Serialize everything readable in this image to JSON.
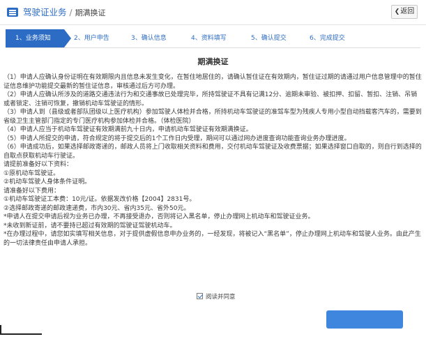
{
  "header": {
    "module": "驾驶证业务",
    "separator": "/",
    "page": "期满换证",
    "back_label": "返回"
  },
  "steps": [
    {
      "label": "1、业务须知",
      "active": true
    },
    {
      "label": "2、用户申告",
      "active": false
    },
    {
      "label": "3、确认信息",
      "active": false
    },
    {
      "label": "4、资料填写",
      "active": false
    },
    {
      "label": "5、确认提交",
      "active": false
    },
    {
      "label": "6、完成提交",
      "active": false
    }
  ],
  "notice": {
    "title": "期满换证",
    "paragraphs": [
      "（1）申请人应确认身份证明在有效期限内且信息未发生变化，在暂住地居住的，请确认暂住证在有效期内，暂住证过期的请通过用户信息管理中的暂住证信息维护功能提交最新的暂住证信息，审核通过后方可办理。",
      "（2）申请人应确认所涉及的道路交通违法行为和交通事故已处理完毕，所持驾驶证不具有记满12分、逾期未审验、被扣押、扣留、暂扣、注销、吊销或者锁定、注销可恢复，撤销机动车驾驶证的情形。",
      "（3）申请人到（县级或者部队团级以上医疗机构）参加驾驶人体检并合格，所持机动车驾驶证的准驾车型为残疾人专用小型自动挡载客汽车的，需要到省级卫生主管部门指定的专门医疗机构参加体检并合格。（体检医院）",
      "（4）申请人应当于机动车驾驶证有效期满前九十日内，申请机动车驾驶证有效期满换证。",
      "（5）申请人所提交的申请，符合规定的将于提交后的1个工作日内受理，期间可以通过网办进度查询功能查询业务办理进度。",
      "（6）申请成功后，如果选择邮政寄递的，邮政人员将上门收取相关资料和费用，交付机动车驾驶证及收费票据；如果选择窗口自取的，则自行到选择的自取点获取机动车行驶证。",
      "请提前准备好以下资料：",
      "①原机动车驾驶证。",
      "②机动车驾驶人身体条件证明。",
      "请准备好以下费用：",
      "①机动车驾驶证工本费：10元/证。依据发改价格【2004】2831号。",
      "②选择邮政寄递的邮政速递费，市内30元、省内35元、省外50元。",
      "*申请人在提交申请后视为业务已办理，不再接受退办，否则将记入黑名单，停止办理网上机动车和驾驶证业务。",
      "*未收到新证前，请不要持已超过有效期的驾驶证驾驶机动车。",
      "*在办理过程中，请您如实填写相关信息，对于提供虚假信息申办业务的，一经发现，将被记入“黑名单”，停止办理网上机动车和驾驶人业务。由此产生的一切法律责任由申请人承担。"
    ]
  },
  "agreement": {
    "label": "阅读并同意",
    "checked": true
  },
  "colors": {
    "accent": "#2d6cc4",
    "button": "#3f87de"
  },
  "icons": {
    "menu": "menu-icon",
    "back": "chevron-left-icon",
    "checkbox": "checkbox-checked-icon"
  }
}
